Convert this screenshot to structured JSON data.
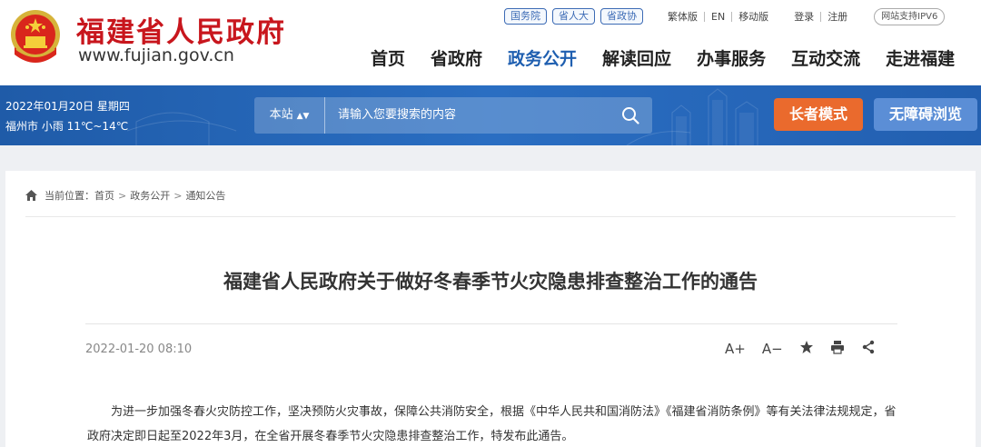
{
  "site": {
    "title": "福建省人民政府",
    "url": "www.fujian.gov.cn"
  },
  "top_links": {
    "pills": [
      "国务院",
      "省人大",
      "省政协"
    ],
    "utils": [
      "繁体版",
      "EN",
      "移动版"
    ],
    "account": [
      "登录",
      "注册"
    ],
    "ipv6": "网站支持IPV6"
  },
  "nav": [
    "首页",
    "省政府",
    "政务公开",
    "解读回应",
    "办事服务",
    "互动交流",
    "走进福建"
  ],
  "nav_active": "政务公开",
  "band": {
    "date": "2022年01月20日 星期四",
    "weather": "福州市 小雨 11℃~14℃"
  },
  "search": {
    "scope": "本站",
    "placeholder": "请输入您要搜索的内容"
  },
  "buttons": {
    "elder": "长者模式",
    "accessibility": "无障碍浏览"
  },
  "breadcrumb": {
    "label": "当前位置：",
    "items": [
      "首页",
      "政务公开",
      "通知公告"
    ]
  },
  "article": {
    "title": "福建省人民政府关于做好冬春季节火灾隐患排查整治工作的通告",
    "date": "2022-01-20 08:10",
    "tools": [
      "A+",
      "A−"
    ],
    "paragraph": "为进一步加强冬春火灾防控工作，坚决预防火灾事故，保障公共消防安全，根据《中华人民共和国消防法》《福建省消防条例》等有关法律法规规定，省政府决定即日起至2022年3月，在全省开展冬春季节火灾隐患排查整治工作，特发布此通告。"
  },
  "colors": {
    "brand_red": "#c8161d",
    "nav_active": "#1f5fb0",
    "band_blue": "#2a6ec2",
    "elder_orange": "#ea6a2d",
    "access_blue": "#5b8ed6"
  }
}
